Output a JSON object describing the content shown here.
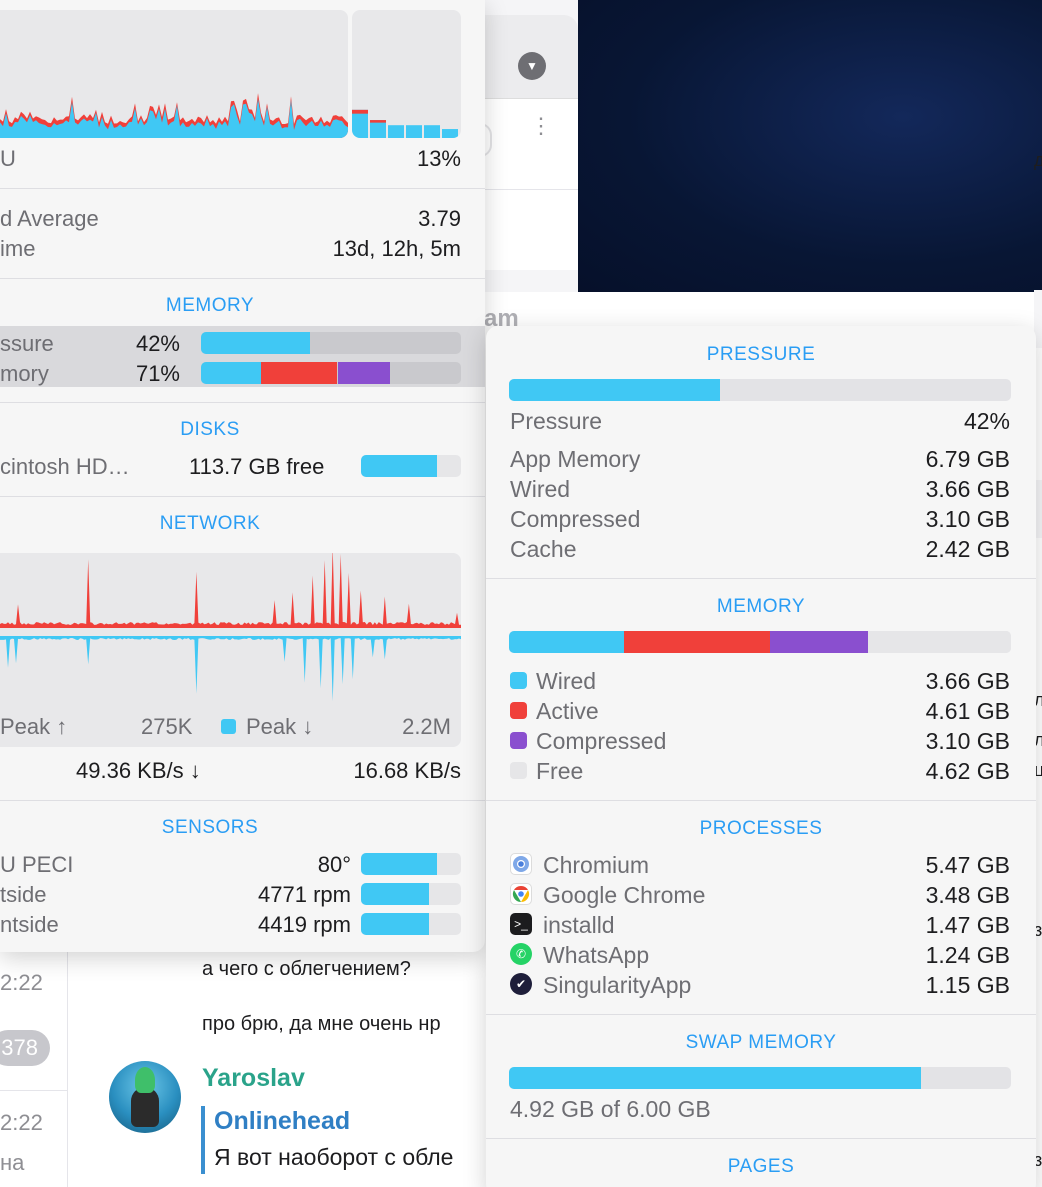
{
  "colors": {
    "accent": "#2a9df4",
    "cyan": "#40c8f4",
    "red": "#f0403a",
    "purple": "#8a4fcf",
    "free": "#e6e6e8",
    "green_name": "#2aa38a"
  },
  "left_panel": {
    "cpu": {
      "label": "U",
      "value": "13%",
      "recent_bars": [
        0.22,
        0.14,
        0.1,
        0.1,
        0.1,
        0.07
      ],
      "recent_bars_red": [
        0.03,
        0.02,
        0.0,
        0.0,
        0.0,
        0.0
      ]
    },
    "load_average": {
      "label": "d Average",
      "value": "3.79"
    },
    "uptime": {
      "label": "ime",
      "value": "13d, 12h, 5m"
    },
    "memory": {
      "title": "MEMORY",
      "pressure": {
        "label": "ssure",
        "value": "42%",
        "fraction": 0.42
      },
      "memory": {
        "label": "mory",
        "value": "71%",
        "segments": [
          {
            "name": "Wired",
            "fraction": 0.23
          },
          {
            "name": "Active",
            "fraction": 0.295
          },
          {
            "name": "Compressed",
            "fraction": 0.2
          }
        ]
      }
    },
    "disks": {
      "title": "DISKS",
      "items": [
        {
          "label": "cintosh HD…",
          "value": "113.7 GB free",
          "fraction": 0.76
        }
      ]
    },
    "network": {
      "title": "NETWORK",
      "peak_up_label": "Peak ↑",
      "peak_up_value": "275K",
      "peak_down_label": "Peak ↓",
      "peak_down_value": "2.2M",
      "down_rate": "49.36 KB/s ↓",
      "up_rate": "16.68 KB/s"
    },
    "sensors": {
      "title": "SENSORS",
      "items": [
        {
          "label": "U PECI",
          "value": "80°",
          "fraction": 0.76
        },
        {
          "label": "tside",
          "value": "4771 rpm",
          "fraction": 0.68
        },
        {
          "label": "ntside",
          "value": "4419 rpm",
          "fraction": 0.68
        }
      ]
    }
  },
  "right_panel": {
    "pressure": {
      "title": "PRESSURE",
      "fraction": 0.42,
      "rows": [
        {
          "label": "Pressure",
          "value": "42%"
        },
        {
          "label": "App Memory",
          "value": "6.79 GB"
        },
        {
          "label": "Wired",
          "value": "3.66 GB"
        },
        {
          "label": "Compressed",
          "value": "3.10 GB"
        },
        {
          "label": "Cache",
          "value": "2.42 GB"
        }
      ]
    },
    "memory": {
      "title": "MEMORY",
      "rows": [
        {
          "label": "Wired",
          "value": "3.66 GB",
          "color": "#40c8f4",
          "fraction": 0.23
        },
        {
          "label": "Active",
          "value": "4.61 GB",
          "color": "#f0403a",
          "fraction": 0.29
        },
        {
          "label": "Compressed",
          "value": "3.10 GB",
          "color": "#8a4fcf",
          "fraction": 0.195
        },
        {
          "label": "Free",
          "value": "4.62 GB",
          "color": "#e6e6e8",
          "fraction": 0.285
        }
      ]
    },
    "processes": {
      "title": "PROCESSES",
      "rows": [
        {
          "label": "Chromium",
          "value": "5.47 GB",
          "icon": "chromium-icon"
        },
        {
          "label": "Google Chrome",
          "value": "3.48 GB",
          "icon": "chrome-icon"
        },
        {
          "label": "installd",
          "value": "1.47 GB",
          "icon": "terminal-icon"
        },
        {
          "label": "WhatsApp",
          "value": "1.24 GB",
          "icon": "whatsapp-icon"
        },
        {
          "label": "SingularityApp",
          "value": "1.15 GB",
          "icon": "singularity-icon"
        }
      ]
    },
    "swap": {
      "title": "SWAP MEMORY",
      "fraction": 0.82,
      "text": "4.92 GB of 6.00 GB"
    },
    "pages": {
      "title": "PAGES"
    }
  },
  "background": {
    "hidden_title": "am",
    "chat": {
      "time1": "2:22",
      "badge": "378",
      "time2": "2:22",
      "preview": "на",
      "msg1": "а чего с облегчением?",
      "msg2": "про брю, да мне очень нр",
      "sender": "Yaroslav",
      "quote_name": "Onlinehead",
      "quote_text": "Я вот наоборот с обле"
    },
    "right_edge_chars": [
      "д",
      "л",
      "л",
      "ц",
      "з",
      "з"
    ]
  }
}
